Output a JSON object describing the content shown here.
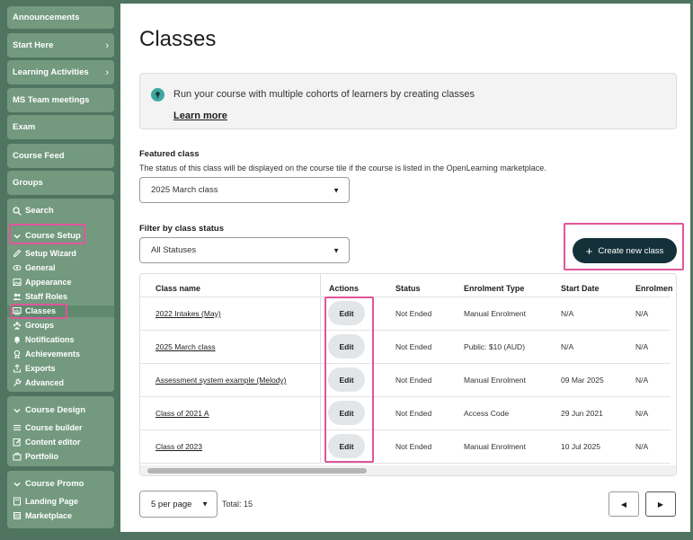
{
  "sidebar": {
    "tiles": [
      {
        "label": "Announcements",
        "chevron": false
      },
      {
        "label": "Start Here",
        "chevron": true
      },
      {
        "label": "Learning Activities",
        "chevron": true
      },
      {
        "label": "MS Team meetings",
        "chevron": false
      },
      {
        "label": "Exam",
        "chevron": false
      },
      {
        "label": "Course Feed",
        "chevron": false
      },
      {
        "label": "Groups",
        "chevron": false
      }
    ],
    "search_label": "Search",
    "course_setup": {
      "label": "Course Setup",
      "items": [
        {
          "label": "Setup Wizard",
          "icon": "pencil-icon"
        },
        {
          "label": "General",
          "icon": "eye-icon"
        },
        {
          "label": "Appearance",
          "icon": "image-icon"
        },
        {
          "label": "Staff Roles",
          "icon": "users-icon"
        },
        {
          "label": "Classes",
          "icon": "classes-icon"
        },
        {
          "label": "Groups",
          "icon": "groups-icon"
        },
        {
          "label": "Notifications",
          "icon": "bell-icon"
        },
        {
          "label": "Achievements",
          "icon": "award-icon"
        },
        {
          "label": "Exports",
          "icon": "export-icon"
        },
        {
          "label": "Advanced",
          "icon": "wrench-icon"
        }
      ]
    },
    "course_design": {
      "label": "Course Design",
      "items": [
        {
          "label": "Course builder",
          "icon": "list-icon"
        },
        {
          "label": "Content editor",
          "icon": "edit-icon"
        },
        {
          "label": "Portfolio",
          "icon": "portfolio-icon"
        }
      ]
    },
    "course_promo": {
      "label": "Course Promo",
      "items": [
        {
          "label": "Landing Page",
          "icon": "page-icon"
        },
        {
          "label": "Marketplace",
          "icon": "store-icon"
        }
      ]
    }
  },
  "main": {
    "title": "Classes",
    "info": {
      "text": "Run your course with multiple cohorts of learners by creating classes",
      "link": "Learn more"
    },
    "featured": {
      "label": "Featured class",
      "description": "The status of this class will be displayed on the course tile if the course is listed in the OpenLearning marketplace.",
      "value": "2025 March class"
    },
    "filter": {
      "label": "Filter by class status",
      "value": "All Statuses"
    },
    "create_button": "Create new class",
    "table": {
      "headers": [
        "Class name",
        "Actions",
        "Status",
        "Enrolment Type",
        "Start Date",
        "Enrolmen"
      ],
      "edit_label": "Edit",
      "rows": [
        {
          "name": "2022 Intakes (May)",
          "status": "Not Ended",
          "enrolment": "Manual Enrolment",
          "start": "N/A",
          "end": "N/A"
        },
        {
          "name": "2025 March class",
          "status": "Not Ended",
          "enrolment": "Public: $10 (AUD)",
          "start": "N/A",
          "end": "N/A"
        },
        {
          "name": "Assessment system example (Melody)",
          "status": "Not Ended",
          "enrolment": "Manual Enrolment",
          "start": "09 Mar 2025",
          "end": "N/A"
        },
        {
          "name": "Class of 2021 A",
          "status": "Not Ended",
          "enrolment": "Access Code",
          "start": "29 Jun 2021",
          "end": "N/A"
        },
        {
          "name": "Class of 2023",
          "status": "Not Ended",
          "enrolment": "Manual Enrolment",
          "start": "10 Jul 2025",
          "end": "N/A"
        }
      ]
    },
    "pagination": {
      "per_page": "5 per page",
      "total": "Total: 15"
    }
  },
  "colors": {
    "sidebar_bg": "#4f7560",
    "sidebar_tile": "#739a7f",
    "accent_dark": "#14313a",
    "highlight": "#e0559a"
  }
}
